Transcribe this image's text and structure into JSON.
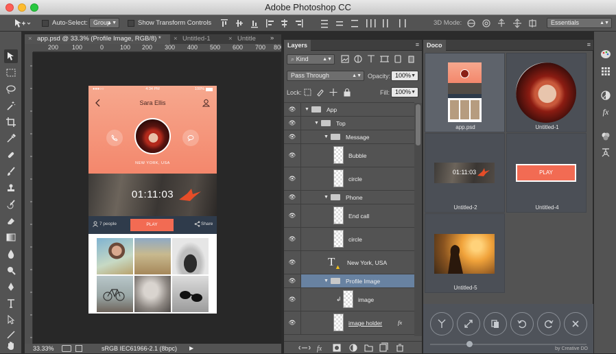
{
  "window": {
    "title": "Adobe Photoshop CC"
  },
  "options": {
    "auto_select_label": "Auto-Select:",
    "auto_select_value": "Group",
    "show_transform_label": "Show Transform Controls",
    "mode_3d_label": "3D Mode:",
    "workspace_value": "Essentials"
  },
  "tabs": [
    "app.psd @ 33.3% (Profile Image, RGB/8) *",
    "Untitled-1",
    "Untitle"
  ],
  "ruler": {
    "h_ticks": [
      "200",
      "100",
      "0",
      "100",
      "200",
      "300",
      "400",
      "500",
      "600",
      "700",
      "800"
    ]
  },
  "status": {
    "zoom": "33.33%",
    "profile": "sRGB IEC61966-2.1 (8bpc)"
  },
  "phone": {
    "status_center": "4:34 PM",
    "status_right": "100%",
    "name": "Sara Ellis",
    "city": "NEW YORK, USA",
    "time": "01:11:03",
    "people": "7 people",
    "play": "PLAY",
    "share": "Share"
  },
  "layers": {
    "tab": "Layers",
    "kind": "Kind",
    "blend": "Pass Through",
    "opacity_label": "Opacity:",
    "opacity_value": "100%",
    "lock_label": "Lock:",
    "fill_label": "Fill:",
    "fill_value": "100%",
    "rows": [
      "App",
      "Top",
      "Message",
      "Bubble",
      "circle",
      "Phone",
      "End call",
      "circle",
      "New York, USA",
      "Profile Image",
      "image",
      "image holder"
    ]
  },
  "doco": {
    "tab": "Doco",
    "items": [
      "app.psd",
      "Untitled-1",
      "Untitled-2",
      "Untitled-4",
      "Untitled-5"
    ],
    "video_time": "01:11:03",
    "play": "PLAY",
    "credit": "by Creative DO"
  },
  "colors": {
    "accent": "#f26b53",
    "selection": "#6882a1",
    "panel": "#535353"
  }
}
